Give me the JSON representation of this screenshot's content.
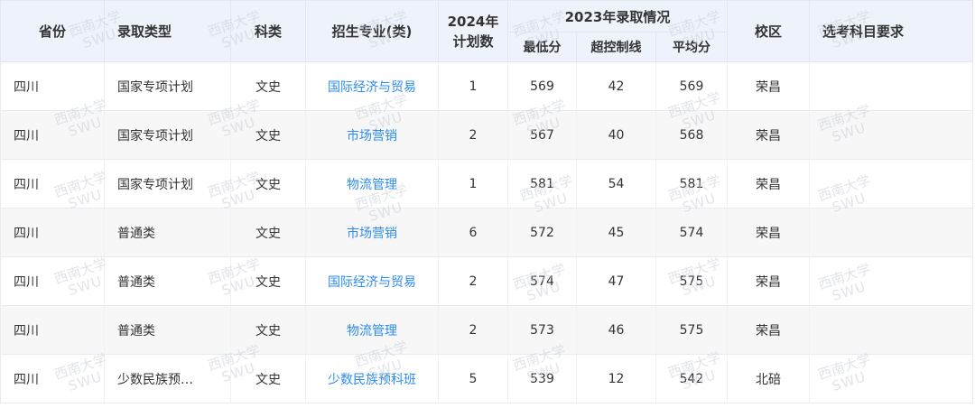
{
  "table": {
    "headers": {
      "province": "省份",
      "admission_type": "录取类型",
      "subject_category": "科类",
      "major": "招生专业(类)",
      "plan_year": "2024年",
      "plan_count": "计划数",
      "result_group": "2023年录取情况",
      "min_score": "最低分",
      "above_line": "超控制线",
      "avg_score": "平均分",
      "campus": "校区",
      "required_subjects": "选考科目要求"
    },
    "rows": [
      {
        "province": "四川",
        "admission_type": "国家专项计划",
        "subject_category": "文史",
        "major": "国际经济与贸易",
        "plan_count": "1",
        "min_score": "569",
        "above_line": "42",
        "avg_score": "569",
        "campus": "荣昌",
        "required_subjects": ""
      },
      {
        "province": "四川",
        "admission_type": "国家专项计划",
        "subject_category": "文史",
        "major": "市场营销",
        "plan_count": "2",
        "min_score": "567",
        "above_line": "40",
        "avg_score": "568",
        "campus": "荣昌",
        "required_subjects": ""
      },
      {
        "province": "四川",
        "admission_type": "国家专项计划",
        "subject_category": "文史",
        "major": "物流管理",
        "plan_count": "1",
        "min_score": "581",
        "above_line": "54",
        "avg_score": "581",
        "campus": "荣昌",
        "required_subjects": ""
      },
      {
        "province": "四川",
        "admission_type": "普通类",
        "subject_category": "文史",
        "major": "市场营销",
        "plan_count": "6",
        "min_score": "572",
        "above_line": "45",
        "avg_score": "574",
        "campus": "荣昌",
        "required_subjects": ""
      },
      {
        "province": "四川",
        "admission_type": "普通类",
        "subject_category": "文史",
        "major": "国际经济与贸易",
        "plan_count": "2",
        "min_score": "574",
        "above_line": "47",
        "avg_score": "575",
        "campus": "荣昌",
        "required_subjects": ""
      },
      {
        "province": "四川",
        "admission_type": "普通类",
        "subject_category": "文史",
        "major": "物流管理",
        "plan_count": "2",
        "min_score": "573",
        "above_line": "46",
        "avg_score": "575",
        "campus": "荣昌",
        "required_subjects": ""
      },
      {
        "province": "四川",
        "admission_type": "少数民族预…",
        "subject_category": "文史",
        "major": "少数民族预科班",
        "plan_count": "5",
        "min_score": "539",
        "above_line": "12",
        "avg_score": "542",
        "campus": "北碚",
        "required_subjects": ""
      }
    ]
  },
  "watermark": {
    "cn": "西南大学",
    "en": "SWU"
  },
  "colors": {
    "header_bg": "#eef3fb",
    "alt_row_bg": "#f7f7f7",
    "link": "#2d8cf0",
    "text": "#333333"
  }
}
